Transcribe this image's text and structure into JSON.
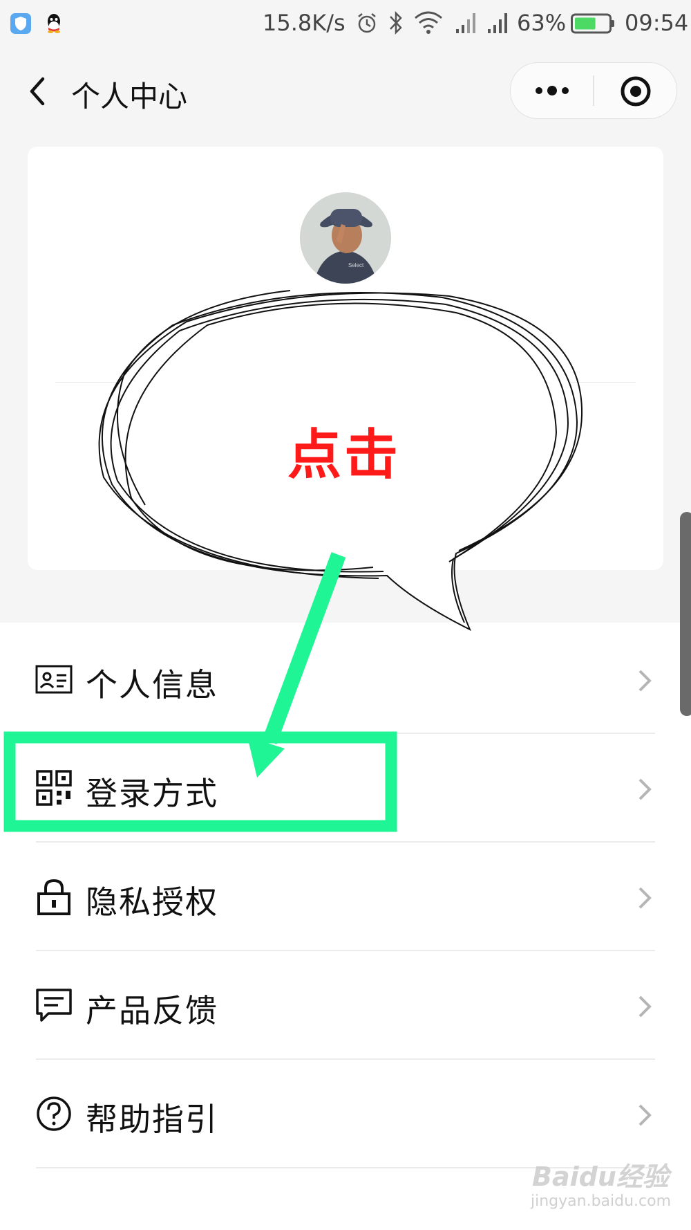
{
  "status_bar": {
    "net_speed": "15.8K/s",
    "battery_percent": "63%",
    "time": "09:54",
    "battery_level": 0.63,
    "icons": [
      "shield-app-icon",
      "qq-icon",
      "alarm-icon",
      "bluetooth-icon",
      "wifi-icon",
      "signal-icon",
      "signal-icon",
      "battery-icon"
    ]
  },
  "header": {
    "title": "个人中心",
    "back_icon": "chevron-left-icon",
    "capsule_icons": [
      "more-dots-icon",
      "target-close-icon"
    ]
  },
  "profile": {
    "avatar": "user-avatar"
  },
  "menu": {
    "items": [
      {
        "label": "个人信息",
        "icon": "id-card-icon"
      },
      {
        "label": "登录方式",
        "icon": "qr-code-icon"
      },
      {
        "label": "隐私授权",
        "icon": "lock-icon"
      },
      {
        "label": "产品反馈",
        "icon": "message-icon"
      },
      {
        "label": "帮助指引",
        "icon": "help-circle-icon"
      }
    ]
  },
  "annotation": {
    "bubble_text": "点击",
    "highlight_color": "#1ff594",
    "text_color": "#ff1a1a"
  },
  "watermark": {
    "brand": "Baidu经验",
    "url": "jingyan.baidu.com"
  }
}
